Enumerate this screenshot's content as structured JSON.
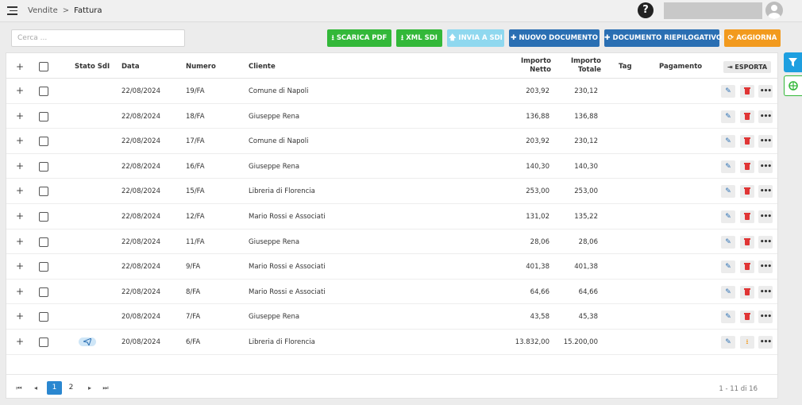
{
  "breadcrumb": {
    "parent": "Vendite",
    "separator": ">",
    "current": "Fattura"
  },
  "header": {
    "help_symbol": "?"
  },
  "search": {
    "placeholder": "Cerca ..."
  },
  "toolbar": {
    "scarica_pdf": "SCARICA PDF",
    "xml_sdi": "XML SDI",
    "invia_sdi": "INVIA A SDI",
    "nuovo_documento": "NUOVO DOCUMENTO",
    "documento_riepilogativo": "DOCUMENTO RIEPILOGATIVO",
    "aggiorna": "AGGIORNA"
  },
  "table": {
    "columns": {
      "stato_sdi": "Stato SdI",
      "data": "Data",
      "numero": "Numero",
      "cliente": "Cliente",
      "importo_netto_1": "Importo",
      "importo_netto_2": "Netto",
      "importo_totale_1": "Importo",
      "importo_totale_2": "Totale",
      "tag": "Tag",
      "pagamento": "Pagamento"
    },
    "export_label": "ESPORTA",
    "rows": [
      {
        "data": "22/08/2024",
        "numero": "19/FA",
        "cliente": "Comune di Napoli",
        "netto": "203,92",
        "totale": "230,12",
        "sent": false
      },
      {
        "data": "22/08/2024",
        "numero": "18/FA",
        "cliente": "Giuseppe Rena",
        "netto": "136,88",
        "totale": "136,88",
        "sent": false
      },
      {
        "data": "22/08/2024",
        "numero": "17/FA",
        "cliente": "Comune di Napoli",
        "netto": "203,92",
        "totale": "230,12",
        "sent": false
      },
      {
        "data": "22/08/2024",
        "numero": "16/FA",
        "cliente": "Giuseppe Rena",
        "netto": "140,30",
        "totale": "140,30",
        "sent": false
      },
      {
        "data": "22/08/2024",
        "numero": "15/FA",
        "cliente": "Libreria di Florencia",
        "netto": "253,00",
        "totale": "253,00",
        "sent": false
      },
      {
        "data": "22/08/2024",
        "numero": "12/FA",
        "cliente": "Mario Rossi e Associati",
        "netto": "131,02",
        "totale": "135,22",
        "sent": false
      },
      {
        "data": "22/08/2024",
        "numero": "11/FA",
        "cliente": "Giuseppe Rena",
        "netto": "28,06",
        "totale": "28,06",
        "sent": false
      },
      {
        "data": "22/08/2024",
        "numero": "9/FA",
        "cliente": "Mario Rossi e Associati",
        "netto": "401,38",
        "totale": "401,38",
        "sent": false
      },
      {
        "data": "22/08/2024",
        "numero": "8/FA",
        "cliente": "Mario Rossi e Associati",
        "netto": "64,66",
        "totale": "64,66",
        "sent": false
      },
      {
        "data": "20/08/2024",
        "numero": "7/FA",
        "cliente": "Giuseppe Rena",
        "netto": "43,58",
        "totale": "45,38",
        "sent": false
      },
      {
        "data": "20/08/2024",
        "numero": "6/FA",
        "cliente": "Libreria di Florencia",
        "netto": "13.832,00",
        "totale": "15.200,00",
        "sent": true
      }
    ]
  },
  "pagination": {
    "page_1": "1",
    "page_2": "2",
    "info": "1 - 11 di 16"
  },
  "icons": {
    "menu": "hamburger-icon",
    "help": "help-icon",
    "download": "download-icon",
    "upload": "upload-icon",
    "plus": "plus-icon",
    "refresh": "refresh-icon",
    "filter": "filter-icon",
    "globe": "globe-icon",
    "edit": "pencil-icon",
    "delete": "trash-icon",
    "more": "ellipsis-icon",
    "sent": "paper-plane-icon"
  },
  "colors": {
    "green": "#33b839",
    "light_blue": "#8fd8ef",
    "blue": "#2a6fb3",
    "orange": "#f29a1e",
    "filter_tab": "#1e9fe0",
    "delete_red": "#e03535"
  }
}
